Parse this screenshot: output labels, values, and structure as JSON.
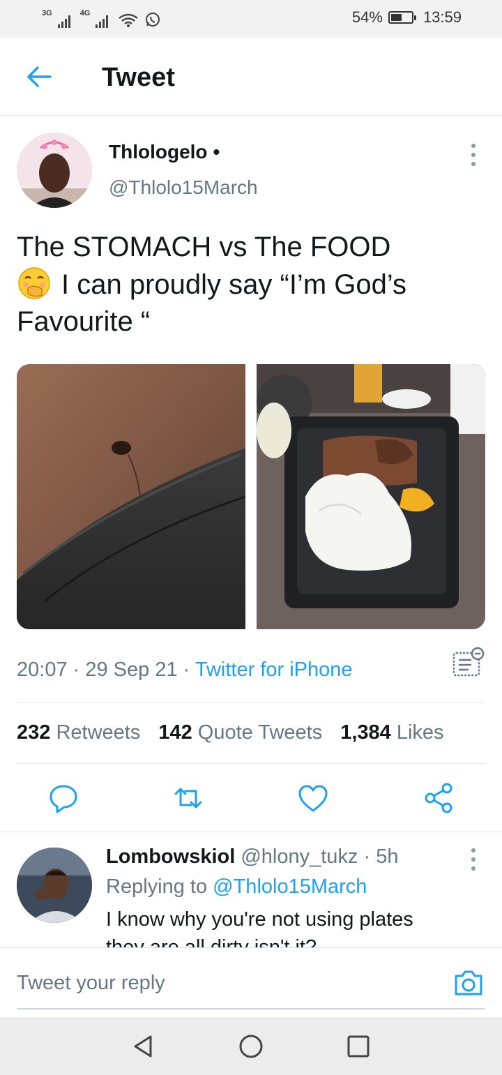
{
  "status_bar": {
    "network_1": "3G",
    "network_2": "4G",
    "battery": "54%",
    "battery_level": 0.54,
    "time": "13:59"
  },
  "header": {
    "title": "Tweet"
  },
  "tweet": {
    "author": {
      "name": "Thlologelo",
      "dot": "•",
      "handle": "@Thlolo15March"
    },
    "text_line1": "The STOMACH vs The  FOOD",
    "text_line2": "I can proudly say “I’m God’s",
    "text_line3": "Favourite “",
    "meta": {
      "time": "20:07",
      "date": "29 Sep 21",
      "source": "Twitter for iPhone"
    },
    "stats": {
      "retweets": "232",
      "retweets_label": "Retweets",
      "quotes": "142",
      "quotes_label": "Quote Tweets",
      "likes": "1,384",
      "likes_label": "Likes"
    }
  },
  "actions": [
    "reply-icon",
    "retweet-icon",
    "like-icon",
    "share-icon"
  ],
  "reply": {
    "name": "Lombowskiol",
    "handle": "@hlony_tukz",
    "sep": "·",
    "age": "5h",
    "replying_prefix": "Replying to",
    "replying_to": "@Thlolo15March",
    "text": "I know why you're not using plates they are all dirty isn't it?"
  },
  "composer": {
    "placeholder": "Tweet your reply"
  },
  "colors": {
    "accent": "#1da1f2",
    "secondary_text": "#657786",
    "divider": "#e1e8ed"
  }
}
